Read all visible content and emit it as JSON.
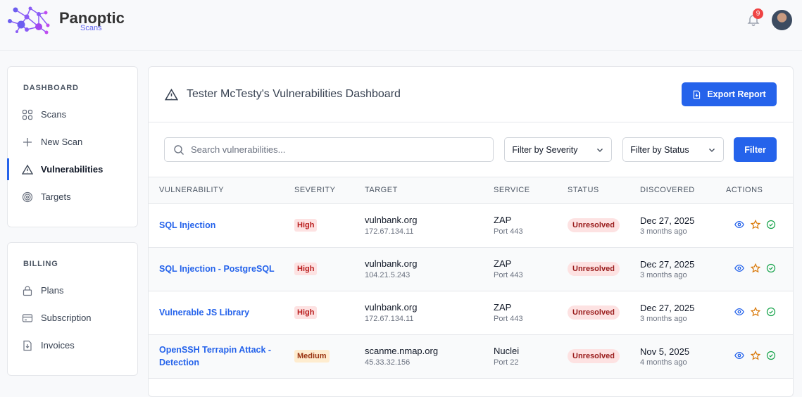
{
  "brand": {
    "name": "Panoptic",
    "sub": "Scans"
  },
  "notifications": {
    "count": "9"
  },
  "sidebar": {
    "dashboard_title": "DASHBOARD",
    "dashboard_items": [
      {
        "label": "Scans"
      },
      {
        "label": "New Scan"
      },
      {
        "label": "Vulnerabilities"
      },
      {
        "label": "Targets"
      }
    ],
    "billing_title": "BILLING",
    "billing_items": [
      {
        "label": "Plans"
      },
      {
        "label": "Subscription"
      },
      {
        "label": "Invoices"
      }
    ]
  },
  "main": {
    "title": "Tester McTesty's Vulnerabilities Dashboard",
    "export_label": "Export Report",
    "search_placeholder": "Search vulnerabilities...",
    "severity_filter": "Filter by Severity",
    "status_filter": "Filter by Status",
    "filter_label": "Filter",
    "columns": [
      "VULNERABILITY",
      "SEVERITY",
      "TARGET",
      "SERVICE",
      "STATUS",
      "DISCOVERED",
      "ACTIONS"
    ],
    "rows": [
      {
        "name": "SQL Injection",
        "severity": "High",
        "host": "vulnbank.org",
        "ip": "172.67.134.11",
        "service": "ZAP",
        "port": "Port 443",
        "status": "Unresolved",
        "date": "Dec 27, 2025",
        "ago": "3 months ago"
      },
      {
        "name": "SQL Injection - PostgreSQL",
        "severity": "High",
        "host": "vulnbank.org",
        "ip": "104.21.5.243",
        "service": "ZAP",
        "port": "Port 443",
        "status": "Unresolved",
        "date": "Dec 27, 2025",
        "ago": "3 months ago"
      },
      {
        "name": "Vulnerable JS Library",
        "severity": "High",
        "host": "vulnbank.org",
        "ip": "172.67.134.11",
        "service": "ZAP",
        "port": "Port 443",
        "status": "Unresolved",
        "date": "Dec 27, 2025",
        "ago": "3 months ago"
      },
      {
        "name": "OpenSSH Terrapin Attack - Detection",
        "severity": "Medium",
        "host": "scanme.nmap.org",
        "ip": "45.33.32.156",
        "service": "Nuclei",
        "port": "Port 22",
        "status": "Unresolved",
        "date": "Nov 5, 2025",
        "ago": "4 months ago"
      }
    ]
  },
  "colors": {
    "accent": "#2563eb",
    "high_bg": "#fde2e2",
    "high_fg": "#b91c1c",
    "medium_bg": "#feeccf",
    "medium_fg": "#9a3412"
  }
}
